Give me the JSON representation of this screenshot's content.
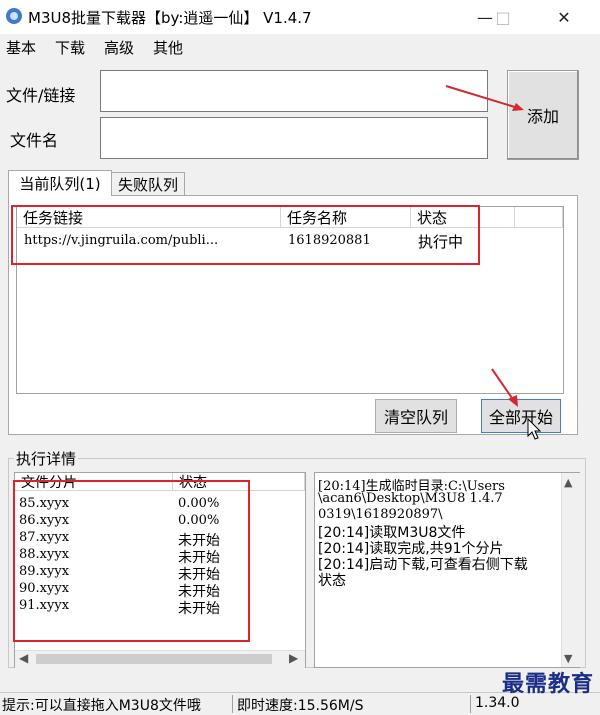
{
  "window": {
    "title": "M3U8批量下载器【by:逍遥一仙】  V1.4.7",
    "minimize": "—",
    "maximize": "□",
    "close": "✕"
  },
  "menu": [
    "基本",
    "下载",
    "高级",
    "其他"
  ],
  "form": {
    "file_link_label": "文件/链接",
    "file_name_label": "文件名",
    "file_link_value": "",
    "file_name_value": "",
    "add_button": "添加"
  },
  "tabs": [
    "当前队列(1)",
    "失败队列"
  ],
  "queue": {
    "columns": [
      "任务链接",
      "任务名称",
      "状态"
    ],
    "rows": [
      {
        "link": "https://v.jingruila.com/publi...",
        "name": "1618920881",
        "status": "执行中"
      }
    ],
    "clear_button": "清空队列",
    "start_all_button": "全部开始"
  },
  "details": {
    "group_title": "执行详情",
    "columns": [
      "文件分片",
      "状态"
    ],
    "fragments": [
      {
        "name": "85.xyyx",
        "status": "0.00%"
      },
      {
        "name": "86.xyyx",
        "status": "0.00%"
      },
      {
        "name": "87.xyyx",
        "status": "未开始"
      },
      {
        "name": "88.xyyx",
        "status": "未开始"
      },
      {
        "name": "89.xyyx",
        "status": "未开始"
      },
      {
        "name": "90.xyyx",
        "status": "未开始"
      },
      {
        "name": "91.xyyx",
        "status": "未开始"
      }
    ],
    "log": [
      "[20:14]生成临时目录:C:\\Users",
      "\\acan6\\Desktop\\M3U8 1.4.7",
      "0319\\1618920897\\",
      "[20:14]读取M3U8文件",
      "[20:14]读取完成,共91个分片",
      "[20:14]启动下载,可查看右侧下载",
      "状态"
    ]
  },
  "statusbar": {
    "hint": "提示:可以直接拖入M3U8文件哦",
    "speed": "即时速度:15.56M/S",
    "version": "1.34.0"
  },
  "watermark": "最需教育",
  "colors": {
    "annotation_red": "#d7262e",
    "window_bg": "#f0f0f0"
  }
}
